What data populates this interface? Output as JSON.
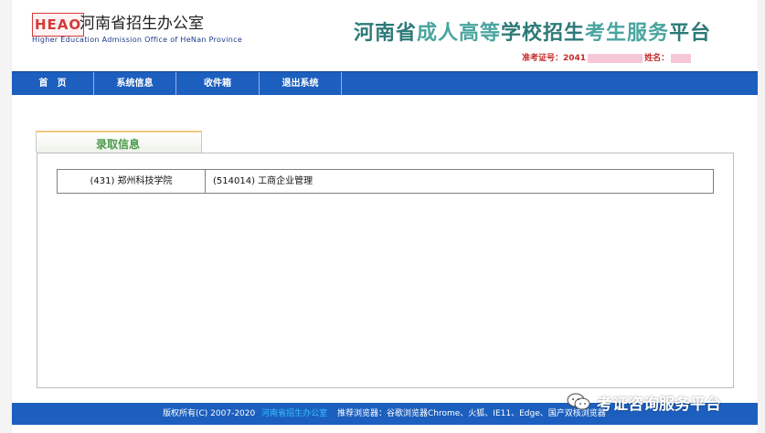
{
  "header": {
    "logo_brand": "HEAO",
    "logo_cn": "河南省招生办公室",
    "logo_en": "Higher Education Admission Office of HeNan Province",
    "title_parts": [
      "河南省",
      "成人高等",
      "学校招生",
      "考生服务",
      "平台"
    ],
    "candidate_label": "准考证号：",
    "candidate_no": "2041",
    "name_label": "姓名："
  },
  "nav": {
    "items": [
      "首　页",
      "系统信息",
      "收件箱",
      "退出系统"
    ]
  },
  "section": {
    "tab_label": "录取信息"
  },
  "result": {
    "school": "(431) 郑州科技学院",
    "major": "(514014) 工商企业管理"
  },
  "footer": {
    "copyright": "版权所有(C) 2007-2020",
    "office_link": "河南省招生办公室",
    "browsers": "推荐浏览器：谷歌浏览器Chrome、火狐、IE11、Edge、国产双核浏览器"
  },
  "watermark": {
    "text": "考证咨询服务平台",
    "icon": "wechat-icon"
  },
  "colors": {
    "nav_blue": "#1c5fbe",
    "title_teal": "#2d7a78",
    "title_light_teal": "#4aa59f",
    "candidate_red": "#c62828",
    "tab_green": "#4c9a4c"
  }
}
